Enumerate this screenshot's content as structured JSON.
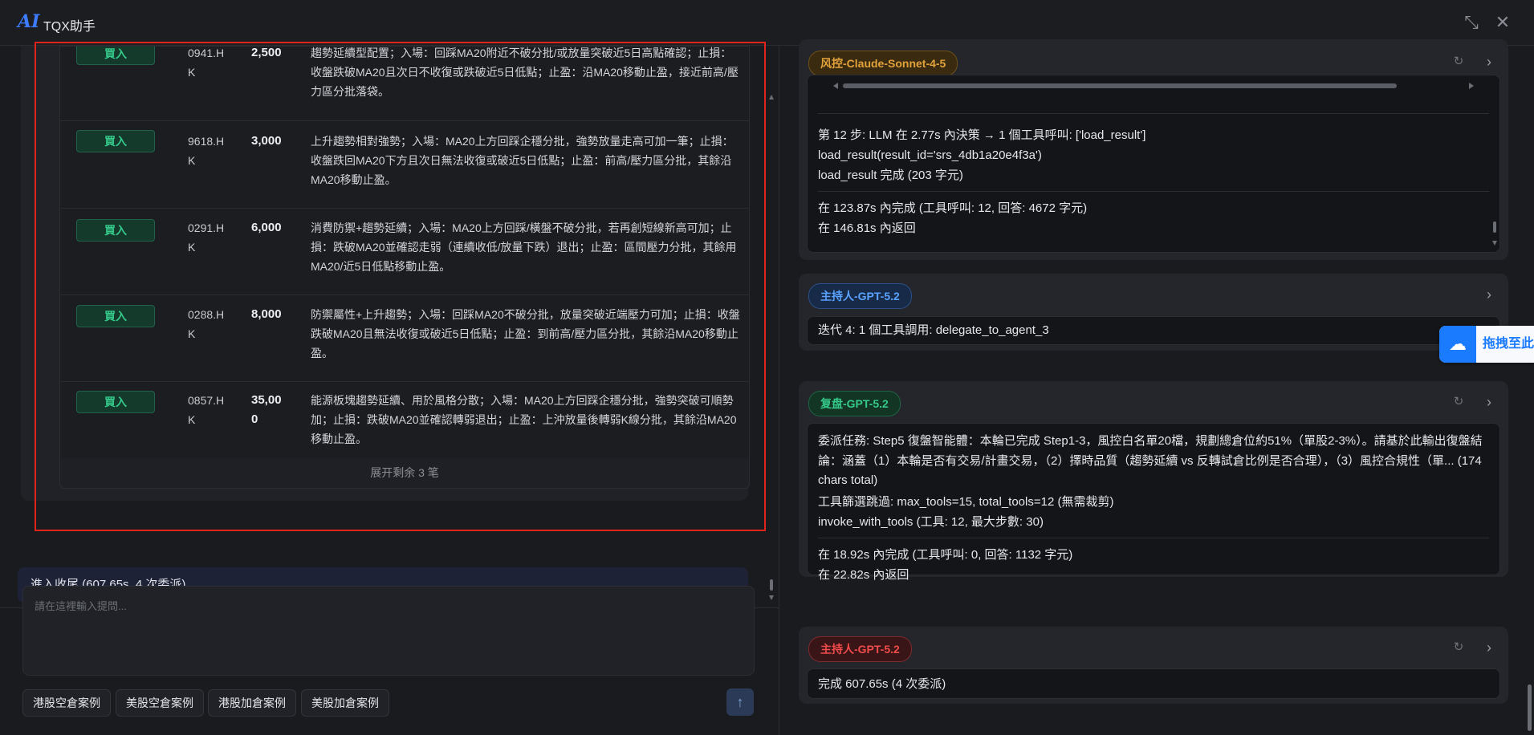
{
  "window": {
    "logo": "AI",
    "title": "TQX助手",
    "minimize_icon": "⤡",
    "close_icon": "✕"
  },
  "trades": {
    "rows": [
      {
        "action": "買入",
        "code": "0941.HK",
        "qty": "2,500",
        "desc": "趨勢延續型配置；入場：回踩MA20附近不破分批/或放量突破近5日高點確認；止損：收盤跌破MA20且次日不收復或跌破近5日低點；止盈：沿MA20移動止盈，接近前高/壓力區分批落袋。"
      },
      {
        "action": "買入",
        "code": "9618.HK",
        "qty": "3,000",
        "desc": "上升趨勢相對強勢；入場：MA20上方回踩企穩分批，強勢放量走高可加一筆；止損：收盤跌回MA20下方且次日無法收復或破近5日低點；止盈：前高/壓力區分批，其餘沿MA20移動止盈。"
      },
      {
        "action": "買入",
        "code": "0291.HK",
        "qty": "6,000",
        "desc": "消費防禦+趨勢延續；入場：MA20上方回踩/橫盤不破分批，若再創短線新高可加；止損：跌破MA20並確認走弱（連續收低/放量下跌）退出；止盈：區間壓力分批，其餘用MA20/近5日低點移動止盈。"
      },
      {
        "action": "買入",
        "code": "0288.HK",
        "qty": "8,000",
        "desc": "防禦屬性+上升趨勢；入場：回踩MA20不破分批，放量突破近端壓力可加；止損：收盤跌破MA20且無法收復或破近5日低點；止盈：到前高/壓力區分批，其餘沿MA20移動止盈。"
      },
      {
        "action": "買入",
        "code": "0857.HK",
        "qty": "35,000",
        "desc": "能源板塊趨勢延續、用於風格分散；入場：MA20上方回踩企穩分批，強勢突破可順勢加；止損：跌破MA20並確認轉弱退出；止盈：上沖放量後轉弱K線分批，其餘沿MA20移動止盈。"
      }
    ],
    "expand_label": "展开剩余 3 笔"
  },
  "status_line": "進入收尾 (607.65s, 4 次委派)",
  "composer": {
    "placeholder": "請在這裡輸入提問...",
    "presets": [
      "港股空倉案例",
      "美股空倉案例",
      "港股加倉案例",
      "美股加倉案例"
    ],
    "send_icon": "↑"
  },
  "messages": {
    "m1": {
      "tag": "风控-Claude-Sonnet-4-5",
      "step_line": "第 12 步: LLM 在 2.77s 內決策 → 1 個工具呼叫: ['load_result']",
      "call_line": "load_result(result_id='srs_4db1a20e4f3a')",
      "done_line": "load_result 完成 (203 字元)",
      "summary1": "在 123.87s 內完成 (工具呼叫: 12, 回答: 4672 字元)",
      "summary2": "在 146.81s 內返回"
    },
    "m2": {
      "tag": "主持人-GPT-5.2",
      "text": "迭代 4: 1 個工具調用: delegate_to_agent_3"
    },
    "m3": {
      "tag": "复盘-GPT-5.2",
      "text": "委派任務: Step5 復盤智能體：本輪已完成 Step1-3，風控白名單20檔，規劃總倉位約51%（單股2-3%）。請基於此輸出復盤結論：涵蓋（1）本輪是否有交易/計畫交易，（2）擇時品質（趨勢延續 vs 反轉試倉比例是否合理），（3）風控合規性（單... (174 chars total)",
      "line2": "工具篩選跳過: max_tools=15, total_tools=12 (無需裁剪)",
      "line3": "invoke_with_tools (工具: 12, 最大步數: 30)",
      "summary1": "在 18.92s 內完成 (工具呼叫: 0, 回答: 1132 字元)",
      "summary2": "在 22.82s 內返回"
    },
    "m4": {
      "tag": "主持人-GPT-5.2",
      "text": "完成 607.65s (4 次委派)"
    }
  },
  "drag_hint": {
    "label": "拖拽至此"
  },
  "colors": {
    "accent_blue": "#3d7bff",
    "buy_green": "#35c98a",
    "risk_orange": "#e2a23a",
    "host_blue": "#5aa2ff",
    "review_green": "#35c98a",
    "host_red": "#ef4b4b",
    "highlight_red": "#e0241c"
  }
}
